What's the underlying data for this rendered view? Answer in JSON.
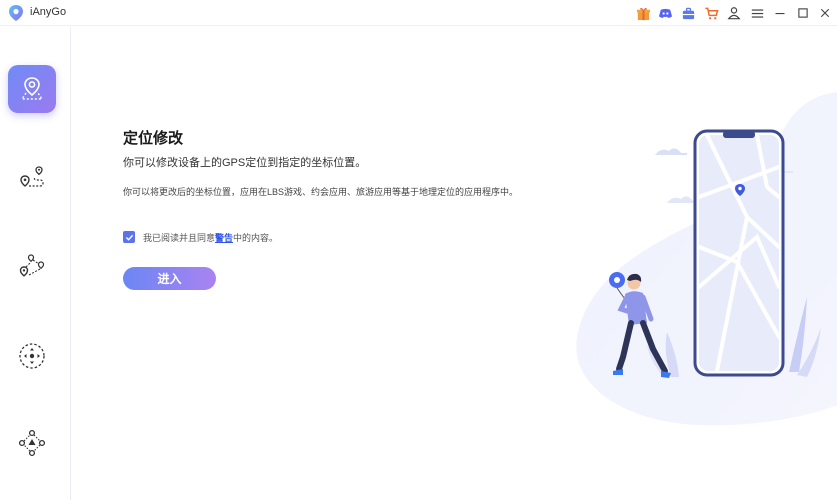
{
  "app": {
    "title": "iAnyGo"
  },
  "titlebar": {
    "icons": [
      "gift-icon",
      "discord-icon",
      "toolbox-icon",
      "cart-icon",
      "account-icon",
      "menu-icon",
      "minimize-icon",
      "maximize-icon",
      "close-icon"
    ]
  },
  "sidebar": {
    "items": [
      {
        "name": "change-location",
        "icon": "location-pin-icon",
        "active": true
      },
      {
        "name": "two-spot-mode",
        "icon": "two-spot-route-icon",
        "active": false
      },
      {
        "name": "multi-spot-mode",
        "icon": "multi-spot-route-icon",
        "active": false
      },
      {
        "name": "joystick-mode",
        "icon": "joystick-icon",
        "active": false
      },
      {
        "name": "gps-import",
        "icon": "directional-move-icon",
        "active": false
      }
    ]
  },
  "main": {
    "title": "定位修改",
    "subtitle": "你可以修改设备上的GPS定位到指定的坐标位置。",
    "description": "你可以将更改后的坐标位置，应用在LBS游戏、约会应用、旅游应用等基于地理定位的应用程序中。",
    "agree_prefix": "我已阅读并且同意",
    "agree_link": "警告",
    "agree_suffix": "中的内容。",
    "agree_checked": true,
    "enter_button": "进入"
  },
  "colors": {
    "accent": "#6b86f3",
    "accent_end": "#a983f2",
    "link": "#2f54eb",
    "checkbox": "#5b73ee"
  }
}
